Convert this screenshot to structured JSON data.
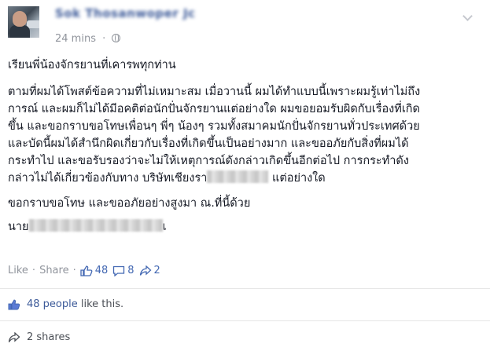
{
  "post": {
    "author_name": "Sok Thosanwoper Jc",
    "timestamp": "24 mins",
    "separator": "·",
    "privacy_icon": "globe-icon",
    "options_icon": "chevron-down-icon"
  },
  "body": {
    "greeting": "เรียนพี่น้องจักรยานที่เคารพทุกท่าน",
    "paragraph_lines": [
      "ตามที่ผมได้โพสต์ข้อความที่ไม่เหมาะสม เมื่อวานนี้ ผมได้ทำแบบนี้เพราะผมรู้เท่าไม่ถึง",
      "การณ์ และผมก็ไม่ได้มีอคติต่อนักปั่นจักรยานแต่อย่างใด ผมขอยอมรับผิดกับเรื่องที่เกิด",
      "ขึ้น และขอกราบขอโทษเพื่อนๆ พี่ๆ น้องๆ รวมทั้งสมาคมนักปั่นจักรยานทั่วประเทศด้วย",
      "และบัดนี้ผมได้สำนึกผิดเกี่ยวกับเรื่องที่เกิดขึ้นเป็นอย่างมาก และขออภัยกับสิ่งที่ผมได้",
      "กระทำไป และขอรับรองว่าจะไม่ให้เหตุการณ์ดังกล่าวเกิดขึ้นอีกต่อไป การกระทำดัง"
    ],
    "last_line_before": "กล่าวไม่ได้เกี่ยวข้องกับทาง บริษัทเชียงรา",
    "last_line_after": " แต่อย่างใด",
    "apology_line": "ขอกราบขอโทษ และขออภัยอย่างสูงมา ณ.ที่นี้ด้วย",
    "signature_prefix": "นาย",
    "signature_suffix": "เ"
  },
  "actions": {
    "like_label": "Like",
    "share_label": "Share",
    "separator": "·",
    "like_count": "48",
    "comment_count": "8",
    "share_count": "2"
  },
  "summary": {
    "likes_text": "48 people",
    "likes_suffix": " like this.",
    "shares_text": "2 shares"
  },
  "colors": {
    "link": "#3b5998",
    "accent": "#4267b2",
    "muted": "#90949c",
    "text": "#141823"
  }
}
